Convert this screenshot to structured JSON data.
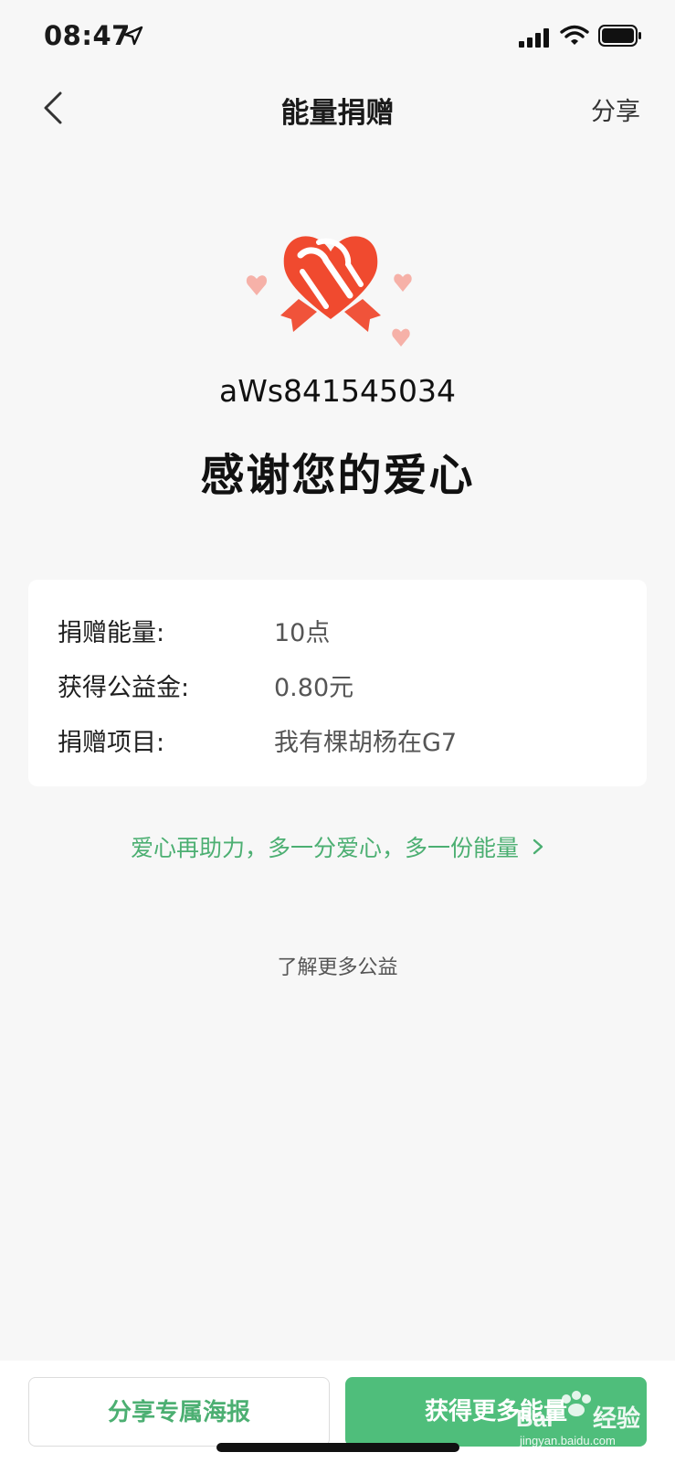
{
  "status_bar": {
    "time": "08:47",
    "icons": [
      "location-arrow-icon",
      "signal-icon",
      "wifi-icon",
      "battery-icon"
    ]
  },
  "nav": {
    "back_icon": "chevron-left-icon",
    "title": "能量捐赠",
    "share_label": "分享"
  },
  "hero": {
    "emblem_icon": "heart-ribbon-icon",
    "username": "aWs841545034",
    "thanks_text": "感谢您的爱心"
  },
  "details": {
    "rows": [
      {
        "label": "捐赠能量:",
        "value": "10点"
      },
      {
        "label": "获得公益金:",
        "value": "0.80元"
      },
      {
        "label": "捐赠项目:",
        "value": "我有棵胡杨在G7"
      }
    ]
  },
  "links": {
    "help_again": "爱心再助力，多一分爱心，多一份能量",
    "help_again_icon": "chevron-right-icon",
    "learn_more": "了解更多公益"
  },
  "bottom": {
    "share_poster_label": "分享专属海报",
    "more_energy_label": "获得更多能量"
  },
  "watermark": {
    "brand": "Baidu经验",
    "url": "jingyan.baidu.com"
  },
  "colors": {
    "accent_green": "#4fbe7b",
    "link_green": "#4caf72",
    "heart_red": "#f04a2f",
    "background": "#f7f7f7"
  }
}
